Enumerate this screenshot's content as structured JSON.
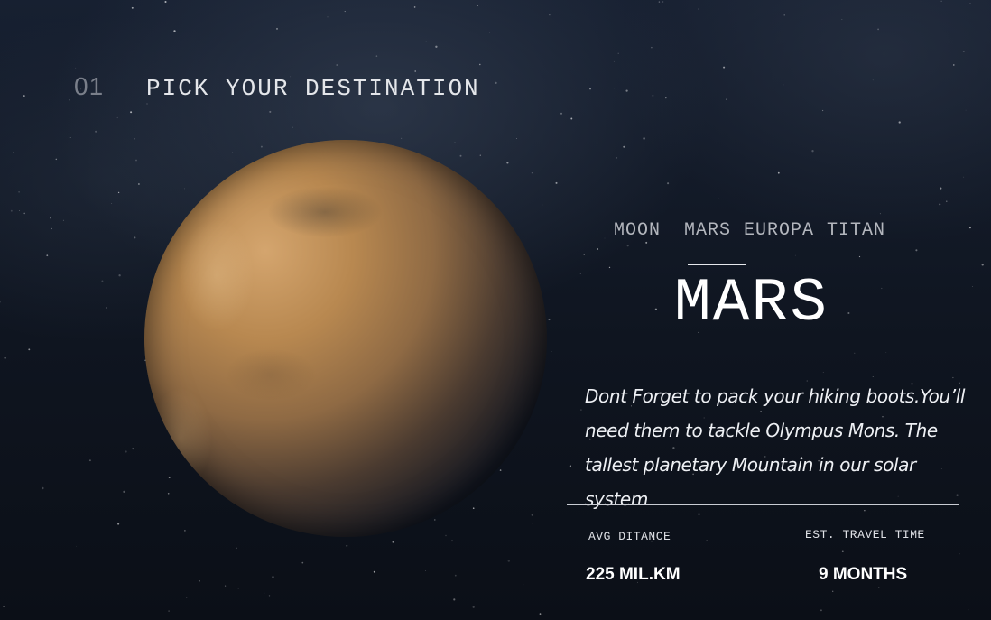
{
  "heading": {
    "number": "01",
    "title": "PICK YOUR DESTINATION"
  },
  "tabs": [
    "MOON",
    "MARS",
    "EUROPA",
    "TITAN"
  ],
  "selected_tab": "MARS",
  "planet": {
    "name": "MARS",
    "description": "Dont Forget to pack your hiking boots.You’ll need them to tackle Olympus Mons. The tallest planetary Mountain in our solar system"
  },
  "stats": {
    "distance_label": "AVG DITANCE",
    "distance_value": "225 MIL.KM",
    "time_label": "EST. TRAVEL TIME",
    "time_value": "9 MONTHS"
  },
  "colors": {
    "background": "#0d1119",
    "accent": "#ffffff",
    "muted": "#7a7f8a"
  }
}
